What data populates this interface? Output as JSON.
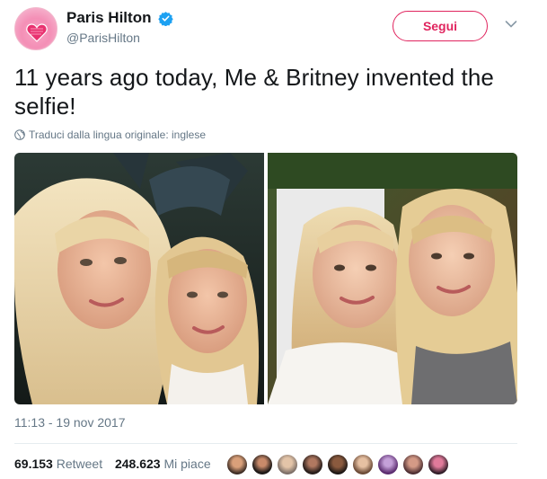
{
  "user": {
    "display_name": "Paris Hilton",
    "handle": "@ParisHilton",
    "verified": true,
    "avatar_icon": "avatar-heart-logo"
  },
  "actions": {
    "follow_label": "Segui"
  },
  "tweet": {
    "text": "11 years ago today, Me & Britney invented the selfie!",
    "translate_label": "Traduci dalla lingua originale: inglese",
    "timestamp": "11:13 - 19 nov 2017"
  },
  "stats": {
    "retweets": "69.153",
    "retweets_label": "Retweet",
    "likes": "248.623",
    "likes_label": "Mi piace"
  },
  "colors": {
    "accent": "#e0245e",
    "verified": "#1da1f2",
    "secondary_text": "#657786"
  }
}
